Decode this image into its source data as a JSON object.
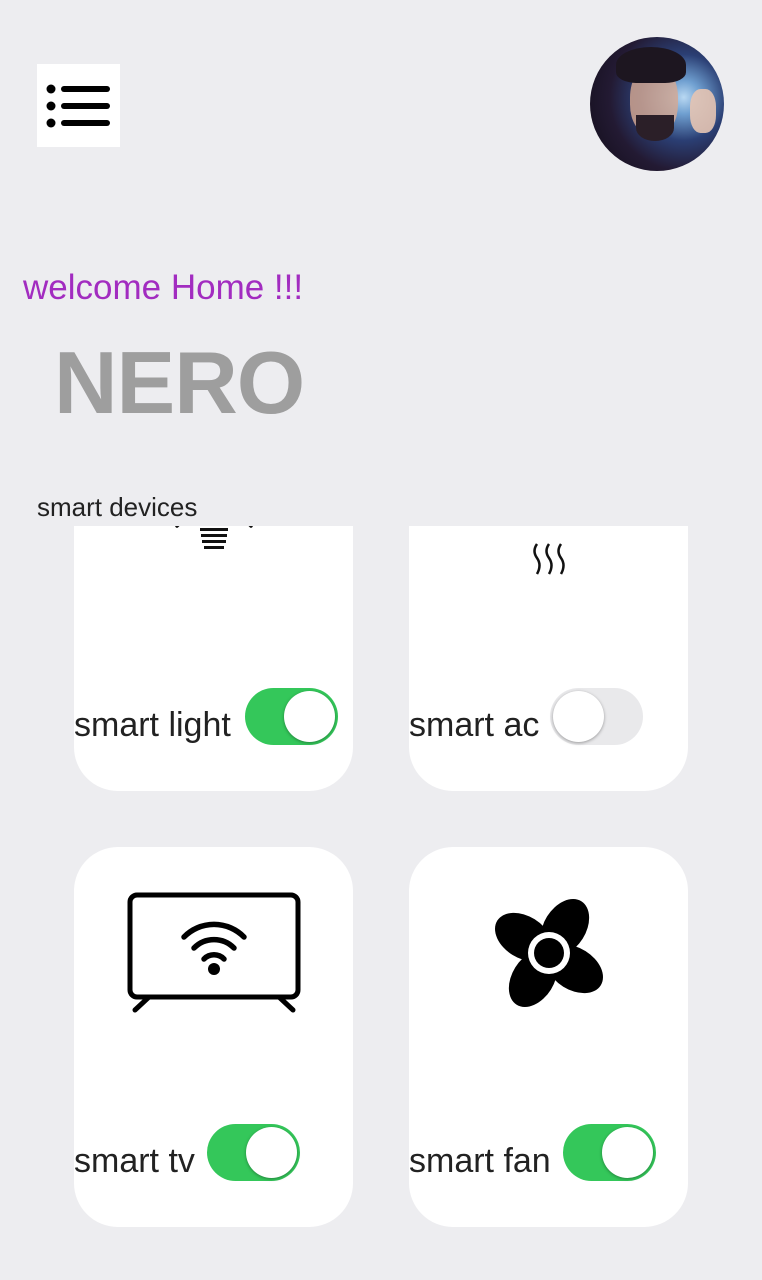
{
  "header": {
    "menu_icon": "list-menu-icon",
    "avatar_icon": "user-avatar"
  },
  "greeting": {
    "welcome": "welcome Home !!!",
    "name": "NERO"
  },
  "devices_section": {
    "title": "smart devices",
    "devices": [
      {
        "label": "smart light",
        "icon": "light-bulb-icon",
        "enabled": true
      },
      {
        "label": "smart ac",
        "icon": "heat-waves-icon",
        "enabled": false
      },
      {
        "label": "smart tv",
        "icon": "smart-tv-icon",
        "enabled": true
      },
      {
        "label": "smart fan",
        "icon": "fan-icon",
        "enabled": true
      }
    ]
  },
  "colors": {
    "background": "#ededf0",
    "card": "#ffffff",
    "welcome_text": "#a22cc0",
    "name_text": "#9e9e9e",
    "toggle_on": "#34c75a",
    "toggle_off": "#e9e9eb"
  }
}
